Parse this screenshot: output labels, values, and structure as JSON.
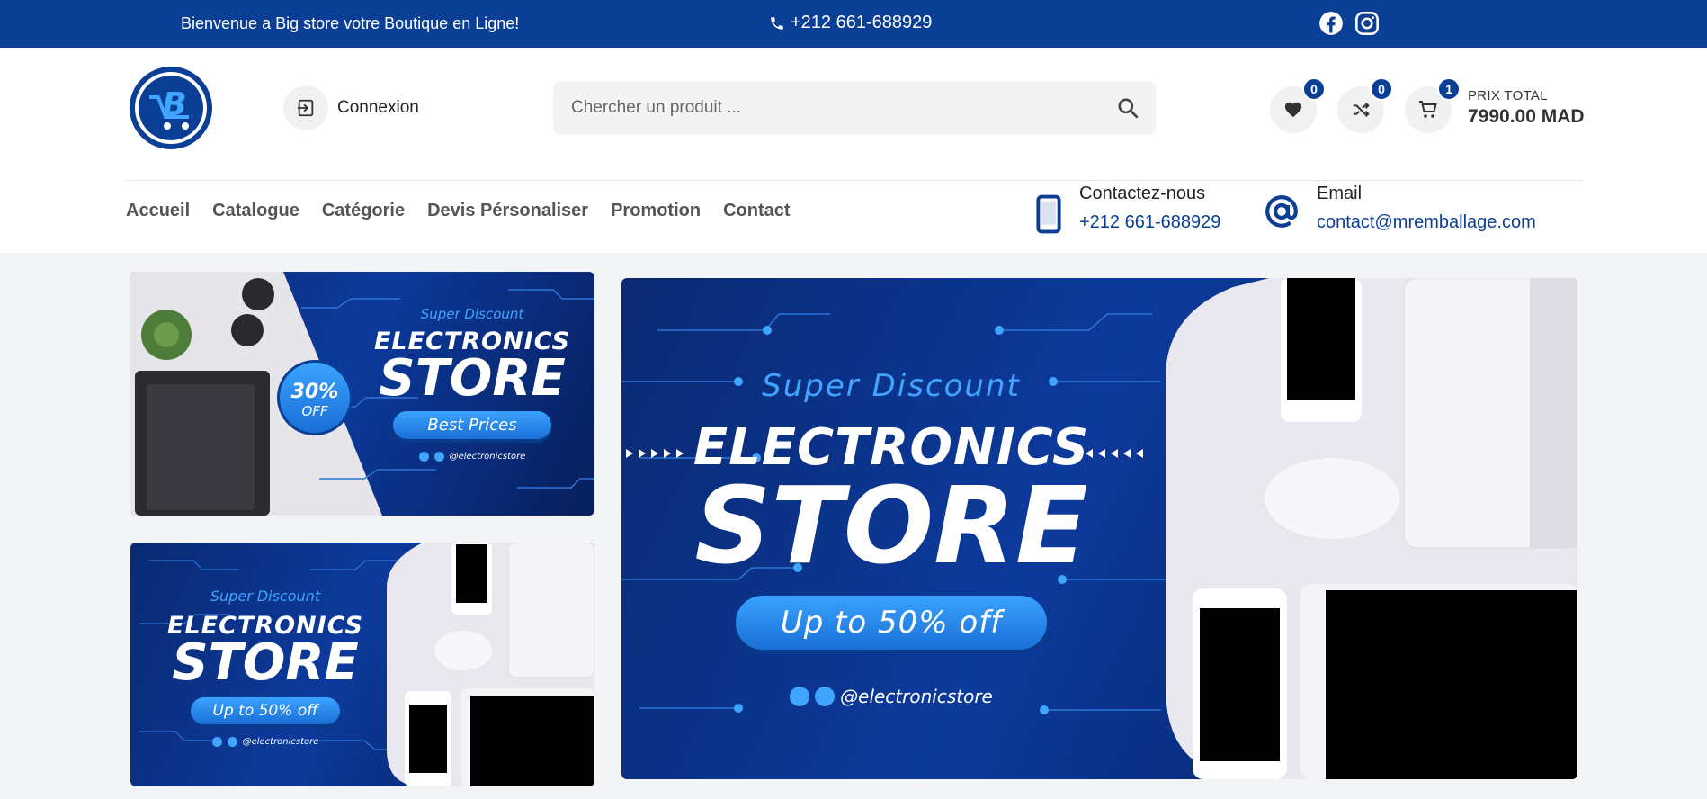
{
  "topbar": {
    "welcome": "Bienvenue a Big store votre Boutique en Ligne!",
    "phone": "+212 661-688929",
    "socials": [
      "facebook-icon",
      "instagram-icon"
    ]
  },
  "header": {
    "login_label": "Connexion",
    "search_placeholder": "Chercher un produit ...",
    "wishlist_count": "0",
    "compare_count": "0",
    "cart_count": "1",
    "total_label": "PRIX TOTAL",
    "total_value": "7990.00 MAD"
  },
  "nav": {
    "items": [
      "Accueil",
      "Catalogue",
      "Catégorie",
      "Devis Pérsonaliser",
      "Promotion",
      "Contact"
    ]
  },
  "contact": {
    "phone_title": "Contactez-nous",
    "phone_value": "+212 661-688929",
    "email_title": "Email",
    "email_value": "contact@mremballage.com"
  },
  "banner_left_top": {
    "super": "Super Discount",
    "line1": "ELECTRONICS",
    "line2": "STORE",
    "button": "Best Prices",
    "discount_pct": "30%",
    "discount_off": "OFF",
    "handle": "@electronicstore"
  },
  "banner_left_bottom": {
    "super": "Super Discount",
    "line1": "ELECTRONICS",
    "line2": "STORE",
    "button": "Up to 50% off",
    "handle": "@electronicstore"
  },
  "banner_main": {
    "super": "Super Discount",
    "line1": "ELECTRONICS",
    "line2": "STORE",
    "button": "Up to 50% off",
    "handle": "@electronicstore"
  },
  "colors": {
    "brand": "#0b3f96",
    "accent": "#3fa5ff"
  }
}
